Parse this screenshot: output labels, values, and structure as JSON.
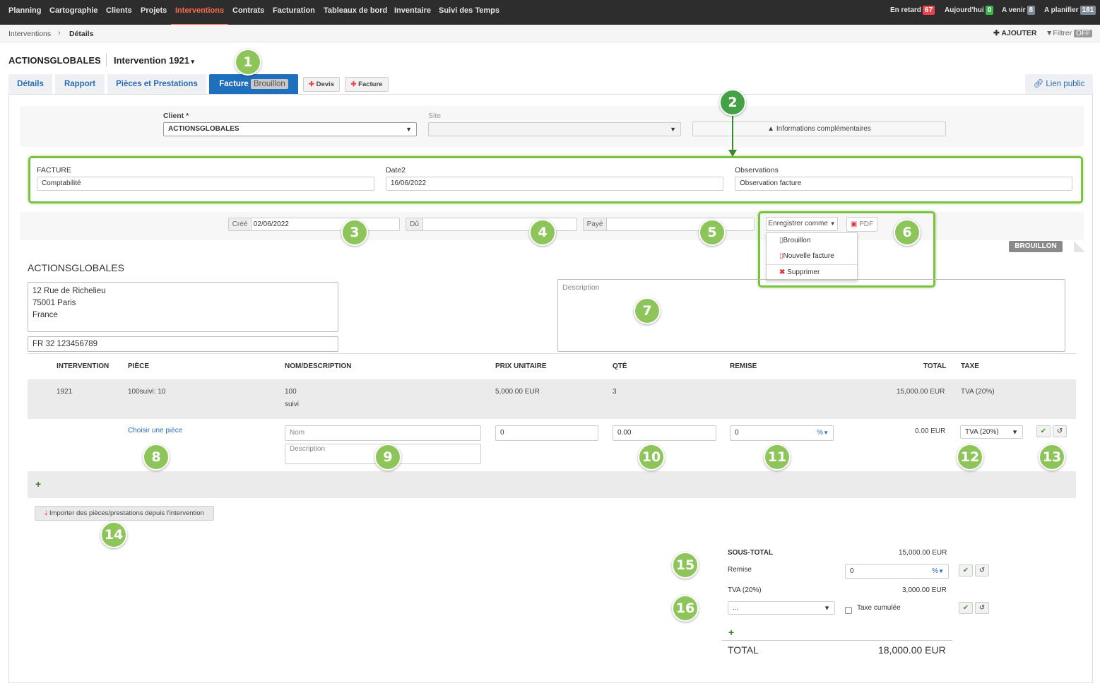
{
  "nav": {
    "items": [
      "Planning",
      "Cartographie",
      "Clients",
      "Projets",
      "Interventions",
      "Contrats",
      "Facturation",
      "Tableaux de bord",
      "Inventaire",
      "Suivi des Temps"
    ],
    "counters": [
      {
        "label": "En retard",
        "count": "67",
        "color": "#e8434e"
      },
      {
        "label": "Aujourd'hui",
        "count": "0",
        "color": "#3ab54a"
      },
      {
        "label": "A venir",
        "count": "8",
        "color": "#7d8a96"
      },
      {
        "label": "A planifier",
        "count": "181",
        "color": "#7d8a96"
      }
    ]
  },
  "breadcrumb": {
    "root": "Interventions",
    "sep": "›",
    "current": "Détails"
  },
  "toolbar": {
    "add": "AJOUTER",
    "filter": "Filtrer",
    "filter_state": "OFF"
  },
  "header": {
    "client": "ACTIONSGLOBALES",
    "intervention": "Intervention 1921"
  },
  "tabs": {
    "details": "Détails",
    "rapport": "Rapport",
    "pieces": "Pièces et Prestations",
    "facture": "Facture",
    "facture_badge": "Brouillon",
    "devis": "Devis",
    "facture_add": "Facture",
    "lien_public": "Lien public"
  },
  "form": {
    "client_label": "Client *",
    "client_value": "ACTIONSGLOBALES",
    "site_label": "Site",
    "info_btn": "Informations complémentaires",
    "facture_label": "FACTURE",
    "facture_value": "Comptabilité",
    "date2_label": "Date2",
    "date2_value": "16/06/2022",
    "obs_label": "Observations",
    "obs_value": "Observation facture",
    "cree_label": "Créé",
    "cree_value": "02/06/2022",
    "du_label": "Dû",
    "paye_label": "Payé",
    "save_as": "Enregistrer comme",
    "pdf": "PDF",
    "menu": [
      "Brouillon",
      "Nouvelle facture",
      "Supprimer"
    ]
  },
  "status_ribbon": "BROUILLON",
  "invoice": {
    "client_name": "ACTIONSGLOBALES",
    "address": [
      "12 Rue de Richelieu",
      "75001 Paris",
      "France"
    ],
    "vat": "FR 32 123456789",
    "description_ph": "Description"
  },
  "table": {
    "headers": [
      "INTERVENTION",
      "PIÈCE",
      "NOM/DESCRIPTION",
      "PRIX UNITAIRE",
      "QTÉ",
      "REMISE",
      "TOTAL",
      "TAXE"
    ],
    "row": {
      "intervention": "1921",
      "piece": "100suivi: 10",
      "nom": "100",
      "desc": "suivi",
      "prix": "5,000.00 EUR",
      "qte": "3",
      "total": "15,000.00 EUR",
      "taxe": "TVA (20%)"
    },
    "new": {
      "choose": "Choisir une pièce",
      "nom_ph": "Nom",
      "desc_ph": "Description",
      "prix": "0",
      "qte": "0.00",
      "remise": "0",
      "remise_unit": "%",
      "total": "0.00 EUR",
      "taxe": "TVA (20%)"
    }
  },
  "import_btn": "Importer des pièces/prestations depuis l'intervention",
  "totals": {
    "sous_total_label": "SOUS-TOTAL",
    "sous_total": "15,000.00 EUR",
    "remise_label": "Remise",
    "remise_value": "0",
    "remise_unit": "%",
    "tva_label": "TVA (20%)",
    "tva": "3,000.00 EUR",
    "tax_select": "...",
    "cumul_label": "Taxe cumulée",
    "total_label": "TOTAL",
    "total": "18,000.00 EUR"
  },
  "callouts": [
    "1",
    "2",
    "3",
    "4",
    "5",
    "6",
    "7",
    "8",
    "9",
    "10",
    "11",
    "12",
    "13",
    "14",
    "15",
    "16"
  ],
  "colors": {
    "accent": "#7cc242",
    "tab_active": "#1f6fbf",
    "nav_bg": "#2d2d2d",
    "active_nav": "#ff6a4d"
  }
}
